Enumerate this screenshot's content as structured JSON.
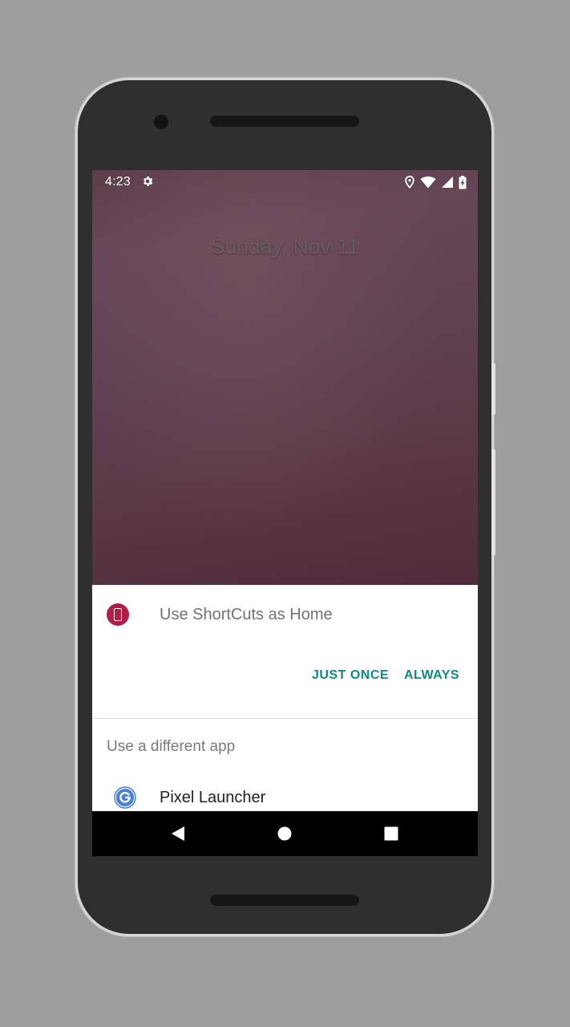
{
  "status_bar": {
    "time": "4:23",
    "icons": [
      "gear-icon",
      "location-icon",
      "wifi-icon",
      "cell-signal-icon",
      "battery-charging-icon"
    ]
  },
  "lockscreen": {
    "date": "Sunday, Nov 11"
  },
  "dialog": {
    "title": "Use ShortCuts as Home",
    "app_icon": "phone-icon",
    "app_icon_color": "#b01e46",
    "just_once_label": "JUST ONCE",
    "always_label": "ALWAYS",
    "accent_color": "#0f8a7f",
    "different_app_label": "Use a different app",
    "apps": [
      {
        "label": "Pixel Launcher",
        "icon": "google-g-icon"
      }
    ]
  },
  "nav_bar": {
    "buttons": [
      "back-icon",
      "home-icon",
      "recents-icon"
    ]
  }
}
